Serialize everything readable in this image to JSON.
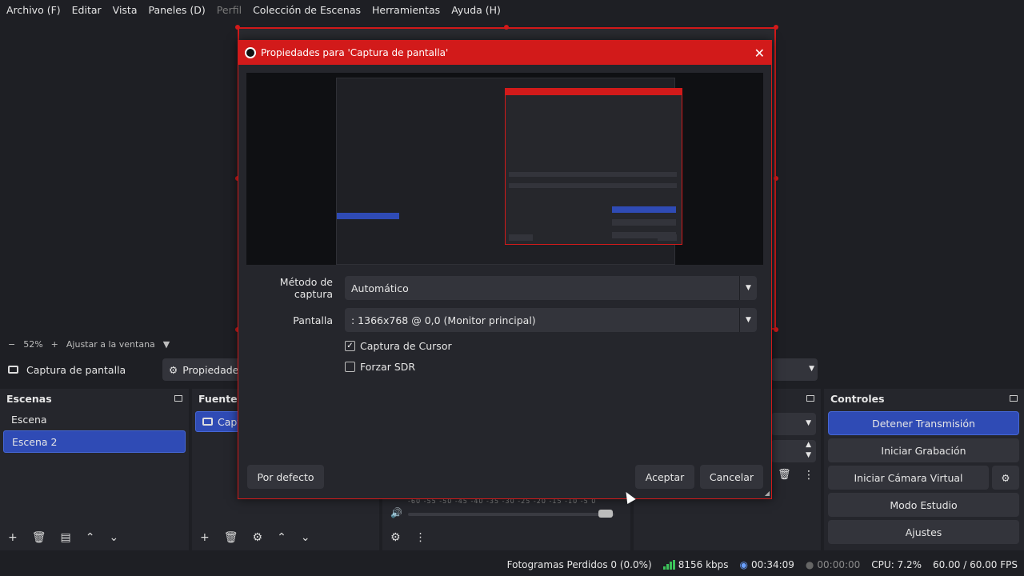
{
  "menu": [
    "Archivo (F)",
    "Editar",
    "Vista",
    "Paneles (D)",
    "Perfil",
    "Colección de Escenas",
    "Herramientas",
    "Ayuda (H)"
  ],
  "zoom": {
    "minus": "−",
    "value": "52%",
    "plus": "+",
    "fit": "Ajustar a la ventana"
  },
  "source_toolbar": {
    "source_name": "Captura de pantalla",
    "properties": "Propiedades"
  },
  "scenes": {
    "title": "Escenas",
    "items": [
      "Escena",
      "Escena 2"
    ],
    "selected": "Escena 2"
  },
  "sources": {
    "title": "Fuentes",
    "item": "Capt"
  },
  "mixer": {
    "scale": "-60  -55  -50  -45  -40  -35  -30  -25  -20  -15  -10   -5    0"
  },
  "controls": {
    "title": "Controles",
    "stop_stream": "Detener Transmisión",
    "start_recording": "Iniciar Grabación",
    "start_virtualcam": "Iniciar Cámara Virtual",
    "studio_mode": "Modo Estudio",
    "settings": "Ajustes"
  },
  "status": {
    "dropped": "Fotogramas Perdidos 0 (0.0%)",
    "bitrate": "8156 kbps",
    "stream_time": "00:34:09",
    "rec_time": "00:00:00",
    "cpu": "CPU: 7.2%",
    "fps": "60.00 / 60.00 FPS"
  },
  "dialog": {
    "title": "Propiedades para 'Captura de pantalla'",
    "capture_method_label": "Método de captura",
    "capture_method_value": "Automático",
    "display_label": "Pantalla",
    "display_value": ": 1366x768 @ 0,0 (Monitor principal)",
    "capture_cursor": "Captura de Cursor",
    "capture_cursor_checked": true,
    "force_sdr": "Forzar SDR",
    "force_sdr_checked": false,
    "defaults": "Por defecto",
    "ok": "Aceptar",
    "cancel": "Cancelar"
  },
  "colors": {
    "accent_red": "#d21a1a",
    "selection_blue": "#2f4bb5",
    "bitrate_green": "#3cc35a"
  }
}
